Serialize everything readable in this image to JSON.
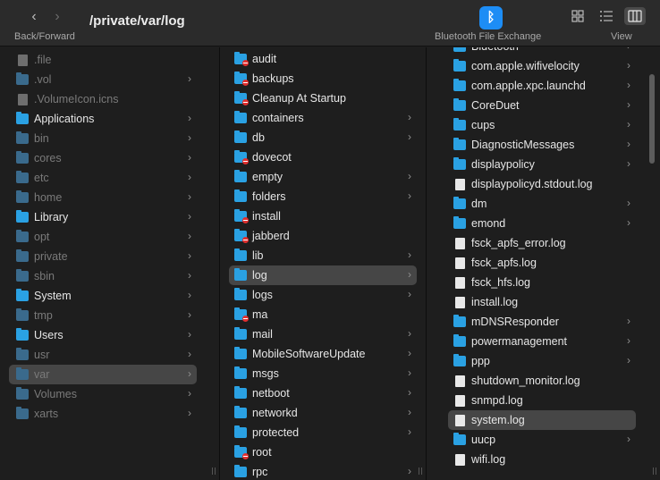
{
  "toolbar": {
    "nav_label": "Back/Forward",
    "path_title": "/private/var/log",
    "bt_label": "Bluetooth File Exchange",
    "view_label": "View"
  },
  "col1": {
    "items": [
      {
        "label": ".file",
        "icon": "file",
        "dim": true,
        "chevron": false
      },
      {
        "label": ".vol",
        "icon": "folder",
        "dim": true,
        "chevron": true
      },
      {
        "label": ".VolumeIcon.icns",
        "icon": "file",
        "dim": true,
        "chevron": false
      },
      {
        "label": "Applications",
        "icon": "folder",
        "dim": false,
        "chevron": true
      },
      {
        "label": "bin",
        "icon": "folder",
        "dim": true,
        "chevron": true
      },
      {
        "label": "cores",
        "icon": "folder",
        "dim": true,
        "chevron": true
      },
      {
        "label": "etc",
        "icon": "folder",
        "dim": true,
        "chevron": true
      },
      {
        "label": "home",
        "icon": "folder",
        "dim": true,
        "chevron": true
      },
      {
        "label": "Library",
        "icon": "folder",
        "dim": false,
        "chevron": true
      },
      {
        "label": "opt",
        "icon": "folder",
        "dim": true,
        "chevron": true
      },
      {
        "label": "private",
        "icon": "folder",
        "dim": true,
        "chevron": true
      },
      {
        "label": "sbin",
        "icon": "folder",
        "dim": true,
        "chevron": true
      },
      {
        "label": "System",
        "icon": "folder",
        "dim": false,
        "chevron": true
      },
      {
        "label": "tmp",
        "icon": "folder",
        "dim": true,
        "chevron": true
      },
      {
        "label": "Users",
        "icon": "folder",
        "dim": false,
        "chevron": true
      },
      {
        "label": "usr",
        "icon": "folder",
        "dim": true,
        "chevron": true
      },
      {
        "label": "var",
        "icon": "folder",
        "dim": true,
        "chevron": true,
        "selected": true
      },
      {
        "label": "Volumes",
        "icon": "folder",
        "dim": true,
        "chevron": true
      },
      {
        "label": "xarts",
        "icon": "folder",
        "dim": true,
        "chevron": true
      }
    ]
  },
  "col2": {
    "items": [
      {
        "label": "audit",
        "icon": "folder-badge",
        "chevron": false
      },
      {
        "label": "backups",
        "icon": "folder-badge",
        "chevron": false
      },
      {
        "label": "Cleanup At Startup",
        "icon": "folder-badge",
        "chevron": false
      },
      {
        "label": "containers",
        "icon": "folder",
        "chevron": true
      },
      {
        "label": "db",
        "icon": "folder",
        "chevron": true
      },
      {
        "label": "dovecot",
        "icon": "folder-badge",
        "chevron": false
      },
      {
        "label": "empty",
        "icon": "folder",
        "chevron": true
      },
      {
        "label": "folders",
        "icon": "folder",
        "chevron": true
      },
      {
        "label": "install",
        "icon": "folder-badge",
        "chevron": false
      },
      {
        "label": "jabberd",
        "icon": "folder-badge",
        "chevron": false
      },
      {
        "label": "lib",
        "icon": "folder",
        "chevron": true
      },
      {
        "label": "log",
        "icon": "folder",
        "chevron": true,
        "selected": true
      },
      {
        "label": "logs",
        "icon": "folder",
        "chevron": true
      },
      {
        "label": "ma",
        "icon": "folder-badge",
        "chevron": false
      },
      {
        "label": "mail",
        "icon": "folder",
        "chevron": true
      },
      {
        "label": "MobileSoftwareUpdate",
        "icon": "folder",
        "chevron": true
      },
      {
        "label": "msgs",
        "icon": "folder",
        "chevron": true
      },
      {
        "label": "netboot",
        "icon": "folder",
        "chevron": true
      },
      {
        "label": "networkd",
        "icon": "folder",
        "chevron": true
      },
      {
        "label": "protected",
        "icon": "folder",
        "chevron": true
      },
      {
        "label": "root",
        "icon": "folder-badge",
        "chevron": false
      },
      {
        "label": "rpc",
        "icon": "folder",
        "chevron": true
      }
    ]
  },
  "col3": {
    "items": [
      {
        "label": "Bluetooth",
        "icon": "folder",
        "chevron": true
      },
      {
        "label": "com.apple.wifivelocity",
        "icon": "folder",
        "chevron": true
      },
      {
        "label": "com.apple.xpc.launchd",
        "icon": "folder",
        "chevron": true
      },
      {
        "label": "CoreDuet",
        "icon": "folder",
        "chevron": true
      },
      {
        "label": "cups",
        "icon": "folder",
        "chevron": true
      },
      {
        "label": "DiagnosticMessages",
        "icon": "folder",
        "chevron": true
      },
      {
        "label": "displaypolicy",
        "icon": "folder",
        "chevron": true
      },
      {
        "label": "displaypolicyd.stdout.log",
        "icon": "file",
        "chevron": false
      },
      {
        "label": "dm",
        "icon": "folder",
        "chevron": true
      },
      {
        "label": "emond",
        "icon": "folder",
        "chevron": true
      },
      {
        "label": "fsck_apfs_error.log",
        "icon": "file",
        "chevron": false
      },
      {
        "label": "fsck_apfs.log",
        "icon": "file",
        "chevron": false
      },
      {
        "label": "fsck_hfs.log",
        "icon": "file",
        "chevron": false
      },
      {
        "label": "install.log",
        "icon": "file",
        "chevron": false
      },
      {
        "label": "mDNSResponder",
        "icon": "folder",
        "chevron": true
      },
      {
        "label": "powermanagement",
        "icon": "folder",
        "chevron": true
      },
      {
        "label": "ppp",
        "icon": "folder",
        "chevron": true
      },
      {
        "label": "shutdown_monitor.log",
        "icon": "file",
        "chevron": false
      },
      {
        "label": "snmpd.log",
        "icon": "file",
        "chevron": false
      },
      {
        "label": "system.log",
        "icon": "file",
        "chevron": false,
        "selected": true
      },
      {
        "label": "uucp",
        "icon": "folder",
        "chevron": true
      },
      {
        "label": "wifi.log",
        "icon": "file",
        "chevron": false
      }
    ]
  }
}
